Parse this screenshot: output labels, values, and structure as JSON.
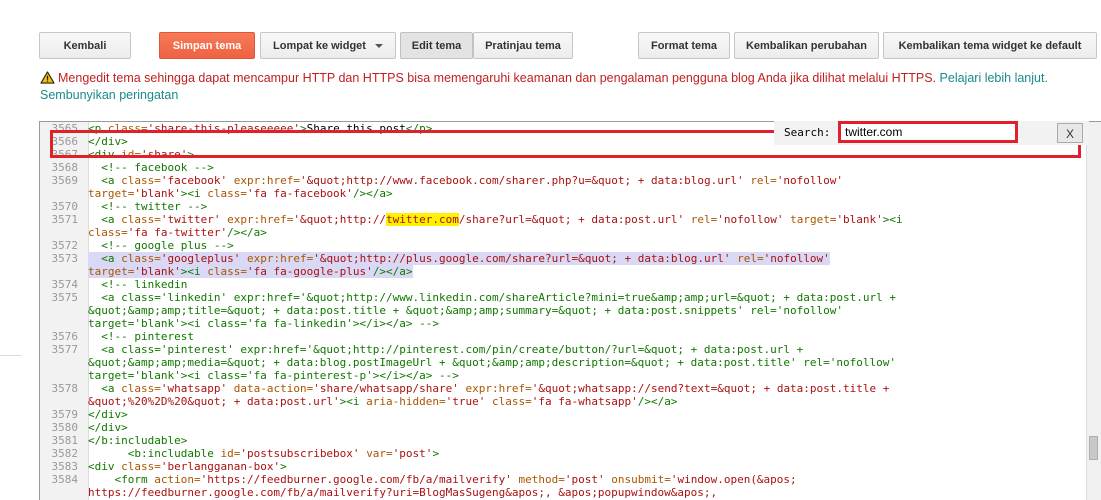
{
  "toolbar": {
    "back": "Kembali",
    "save": "Simpan tema",
    "jump": "Lompat ke widget",
    "edit": "Edit tema",
    "preview": "Pratinjau tema",
    "format": "Format tema",
    "revert": "Kembalikan perubahan",
    "revert_widget": "Kembalikan tema widget ke default"
  },
  "warning": {
    "text": "Mengedit tema sehingga dapat mencampur HTTP dan HTTPS bisa memengaruhi keamanan dan pengalaman pengguna blog Anda jika dilihat melalui HTTPS. ",
    "learn_more": "Pelajari lebih lanjut.",
    "hide": "Sembunyikan peringatan"
  },
  "search": {
    "label": "Search:",
    "value": "twitter.com",
    "close": "X"
  },
  "colors": {
    "accent": "#f26b4a",
    "warning": "#c21f1f",
    "link": "#1a8a8a",
    "highlight": "#e0202a"
  },
  "editor": {
    "lines": [
      {
        "n": "3565",
        "html": "<span class='t'>&lt;p</span> <span class='a'>class=</span><span class='s'>'share-this-pleaseeeee'</span><span class='t'>&gt;</span>Share this post<span class='t'>&lt;/p&gt;</span>"
      },
      {
        "n": "3566",
        "html": "<span class='t'>&lt;/div&gt;</span>"
      },
      {
        "n": "3567",
        "html": "<span class='t'>&lt;div</span> <span class='a'>id=</span><span class='s'>'share'</span><span class='t'>&gt;</span>"
      },
      {
        "n": "3568",
        "html": "  <span class='c'>&lt;!-- facebook --&gt;</span>"
      },
      {
        "n": "3569",
        "html": "  <span class='t'>&lt;a</span> <span class='a'>class=</span><span class='s'>'facebook'</span> <span class='a'>expr:href=</span><span class='s'>'&amp;quot;http://www.facebook.com/sharer.php?u=&amp;quot; + data:blog.url'</span> <span class='a'>rel=</span><span class='s'>'nofollow'</span>"
      },
      {
        "n": "",
        "html": "<span class='a'>target=</span><span class='s'>'blank'</span><span class='t'>&gt;&lt;i</span> <span class='a'>class=</span><span class='s'>'fa fa-facebook'</span><span class='t'>/&gt;&lt;/a&gt;</span>"
      },
      {
        "n": "3570",
        "html": "  <span class='c'>&lt;!-- twitter --&gt;</span>"
      },
      {
        "n": "3571",
        "html": "  <span class='t'>&lt;a</span> <span class='a'>class=</span><span class='s'>'twitter'</span> <span class='a'>expr:href=</span><span class='s'>'&amp;quot;http://<span class='mark'>twitter.com</span>/share?url=&amp;quot; + data:post.url'</span> <span class='a'>rel=</span><span class='s'>'nofollow'</span> <span class='a'>target=</span><span class='s'>'blank'</span><span class='t'>&gt;&lt;i</span>"
      },
      {
        "n": "",
        "html": "<span class='a'>class=</span><span class='s'>'fa fa-twitter'</span><span class='t'>/&gt;&lt;/a&gt;</span>"
      },
      {
        "n": "3572",
        "html": "  <span class='c'>&lt;!-- google plus --&gt;</span>"
      },
      {
        "n": "3573",
        "sel": true,
        "html": "  <span class='t'>&lt;a</span> <span class='a'>class=</span><span class='s'>'googleplus'</span> <span class='a'>expr:href=</span><span class='s'>'&amp;quot;http://plus.google.com/share?url=&amp;quot; + data:blog.url'</span> <span class='a'>rel=</span><span class='s'>'nofollow'</span>"
      },
      {
        "n": "",
        "sel": true,
        "html": "<span class='a'>target=</span><span class='s'>'blank'</span><span class='t'>&gt;&lt;i</span> <span class='a'>class=</span><span class='s'>'fa fa-google-plus'</span><span class='t'>/&gt;&lt;/a&gt;</span>"
      },
      {
        "n": "3574",
        "html": "  <span class='c'>&lt;!-- linkedin</span>"
      },
      {
        "n": "3575",
        "html": "  <span class='c'>&lt;a class='linkedin' expr:href='&amp;quot;http://www.linkedin.com/shareArticle?mini=true&amp;amp;amp;url=&amp;quot; + data:post.url +</span>"
      },
      {
        "n": "",
        "html": "<span class='c'>&amp;quot;&amp;amp;amp;title=&amp;quot; + data:post.title + &amp;quot;&amp;amp;amp;summary=&amp;quot; + data:post.snippets' rel='nofollow'</span>"
      },
      {
        "n": "",
        "html": "<span class='c'>target='blank'&gt;&lt;i class='fa fa-linkedin'&gt;&lt;/i&gt;&lt;/a&gt; --&gt;</span>"
      },
      {
        "n": "3576",
        "html": "  <span class='c'>&lt;!-- pinterest</span>"
      },
      {
        "n": "3577",
        "html": "  <span class='c'>&lt;a class='pinterest' expr:href='&amp;quot;http://pinterest.com/pin/create/button/?url=&amp;quot; + data:post.url +</span>"
      },
      {
        "n": "",
        "html": "<span class='c'>&amp;quot;&amp;amp;amp;media=&amp;quot; + data:blog.postImageUrl + &amp;quot;&amp;amp;amp;description=&amp;quot; + data:post.title' rel='nofollow'</span>"
      },
      {
        "n": "",
        "html": "<span class='c'>target='blank'&gt;&lt;i class='fa fa-pinterest-p'&gt;&lt;/i&gt;&lt;/a&gt; --&gt;</span>"
      },
      {
        "n": "3578",
        "html": "  <span class='t'>&lt;a</span> <span class='a'>class=</span><span class='s'>'whatsapp'</span> <span class='a'>data-action=</span><span class='s'>'share/whatsapp/share'</span> <span class='a'>expr:href=</span><span class='s'>'&amp;quot;whatsapp://send?text=&amp;quot; + data:post.title +</span>"
      },
      {
        "n": "",
        "html": "<span class='s'>&amp;quot;%20%2D%20&amp;quot; + data:post.url'</span><span class='t'>&gt;&lt;i</span> <span class='a'>aria-hidden=</span><span class='s'>'true'</span> <span class='a'>class=</span><span class='s'>'fa fa-whatsapp'</span><span class='t'>/&gt;&lt;/a&gt;</span>"
      },
      {
        "n": "3579",
        "html": "<span class='t'>&lt;/div&gt;</span>"
      },
      {
        "n": "3580",
        "html": "<span class='t'>&lt;/div&gt;</span>"
      },
      {
        "n": "3581",
        "html": "<span class='t'>&lt;/b:includable&gt;</span>"
      },
      {
        "n": "3582",
        "html": "      <span class='t'>&lt;b:includable</span> <span class='a'>id=</span><span class='s'>'postsubscribebox'</span> <span class='a'>var=</span><span class='s'>'post'</span><span class='t'>&gt;</span>"
      },
      {
        "n": "3583",
        "html": "<span class='t'>&lt;div</span> <span class='a'>class=</span><span class='s'>'berlangganan-box'</span><span class='t'>&gt;</span>"
      },
      {
        "n": "3584",
        "html": "    <span class='t'>&lt;form</span> <span class='a'>action=</span><span class='s'>'https://feedburner.google.com/fb/a/mailverify'</span> <span class='a'>method=</span><span class='s'>'post'</span> <span class='a'>onsubmit=</span><span class='s'>'window.open(&amp;apos;</span>"
      },
      {
        "n": "",
        "html": "<span class='s'>https://feedburner.google.com/fb/a/mailverify?uri=BlogMasSugeng&amp;apos;, &amp;apos;popupwindow&amp;apos;,</span>"
      }
    ]
  }
}
